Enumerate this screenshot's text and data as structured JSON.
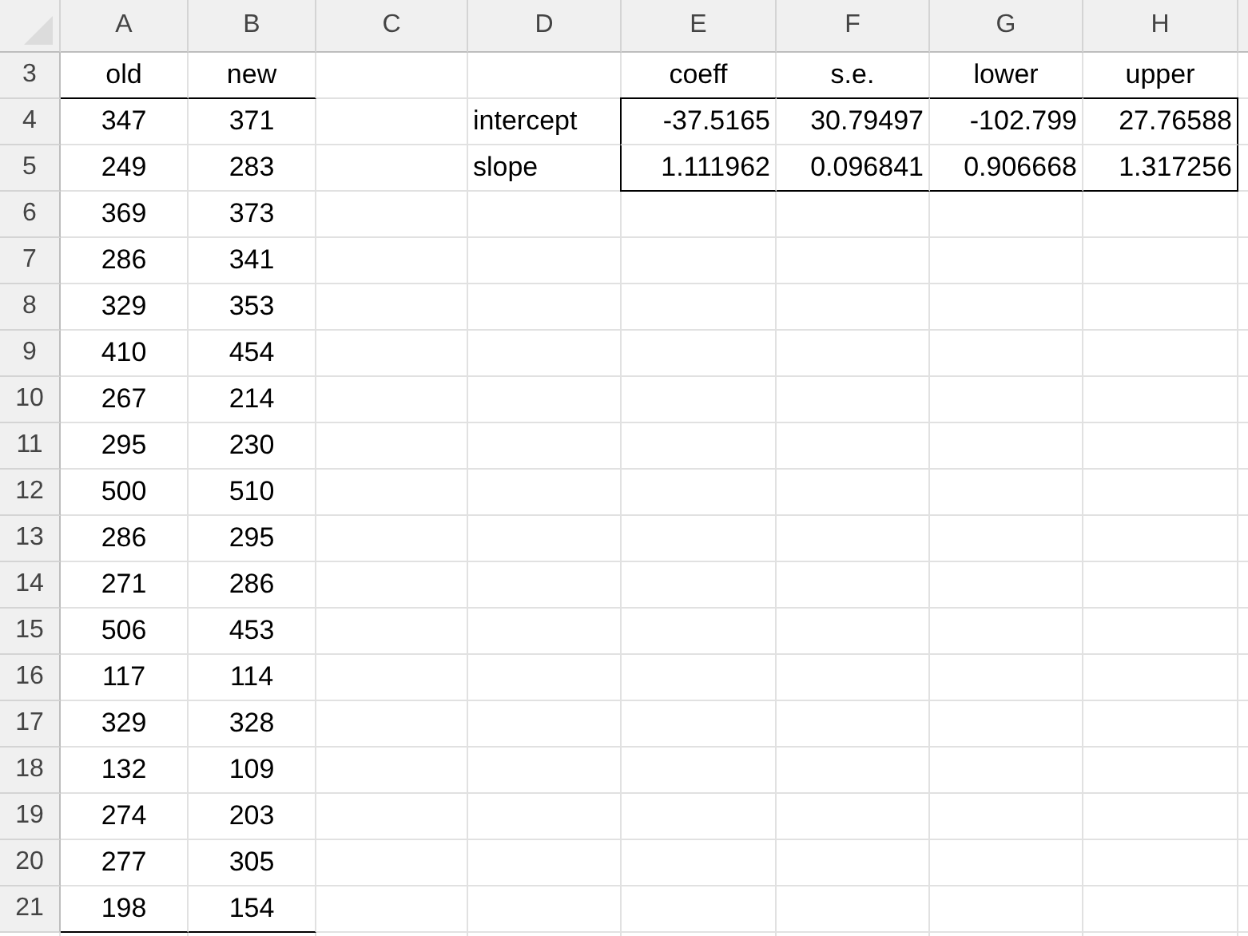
{
  "columns": [
    "A",
    "B",
    "C",
    "D",
    "E",
    "F",
    "G",
    "H"
  ],
  "rows": [
    {
      "number": "3",
      "cells": [
        {
          "text": "old",
          "rule_below": true
        },
        {
          "text": "new",
          "rule_below": true
        },
        null,
        null,
        {
          "text": "coeff"
        },
        {
          "text": "s.e."
        },
        {
          "text": "lower"
        },
        {
          "text": "upper"
        }
      ]
    },
    {
      "number": "4",
      "cells": [
        {
          "text": "347"
        },
        {
          "text": "371"
        },
        null,
        {
          "text": "intercept"
        },
        {
          "text": "-37.5165",
          "boxed": true
        },
        {
          "text": "30.79497",
          "boxed": true
        },
        {
          "text": "-102.799",
          "boxed": true
        },
        {
          "text": "27.76588",
          "boxed": true
        }
      ]
    },
    {
      "number": "5",
      "cells": [
        {
          "text": "249"
        },
        {
          "text": "283"
        },
        null,
        {
          "text": "slope"
        },
        {
          "text": "1.111962",
          "boxed": true
        },
        {
          "text": "0.096841",
          "boxed": true
        },
        {
          "text": "0.906668",
          "boxed": true
        },
        {
          "text": "1.317256",
          "boxed": true
        }
      ]
    },
    {
      "number": "6",
      "cells": [
        {
          "text": "369"
        },
        {
          "text": "373"
        }
      ]
    },
    {
      "number": "7",
      "cells": [
        {
          "text": "286"
        },
        {
          "text": "341"
        }
      ]
    },
    {
      "number": "8",
      "cells": [
        {
          "text": "329"
        },
        {
          "text": "353"
        }
      ]
    },
    {
      "number": "9",
      "cells": [
        {
          "text": "410"
        },
        {
          "text": "454"
        }
      ]
    },
    {
      "number": "10",
      "cells": [
        {
          "text": "267"
        },
        {
          "text": "214"
        }
      ]
    },
    {
      "number": "11",
      "cells": [
        {
          "text": "295"
        },
        {
          "text": "230"
        }
      ]
    },
    {
      "number": "12",
      "cells": [
        {
          "text": "500"
        },
        {
          "text": "510"
        }
      ]
    },
    {
      "number": "13",
      "cells": [
        {
          "text": "286"
        },
        {
          "text": "295"
        }
      ]
    },
    {
      "number": "14",
      "cells": [
        {
          "text": "271"
        },
        {
          "text": "286"
        }
      ]
    },
    {
      "number": "15",
      "cells": [
        {
          "text": "506"
        },
        {
          "text": "453"
        }
      ]
    },
    {
      "number": "16",
      "cells": [
        {
          "text": "117"
        },
        {
          "text": "114"
        }
      ]
    },
    {
      "number": "17",
      "cells": [
        {
          "text": "329"
        },
        {
          "text": "328"
        }
      ]
    },
    {
      "number": "18",
      "cells": [
        {
          "text": "132"
        },
        {
          "text": "109"
        }
      ]
    },
    {
      "number": "19",
      "cells": [
        {
          "text": "274"
        },
        {
          "text": "203"
        }
      ]
    },
    {
      "number": "20",
      "cells": [
        {
          "text": "277"
        },
        {
          "text": "305"
        }
      ]
    },
    {
      "number": "21",
      "cells": [
        {
          "text": "198",
          "rule_below": true
        },
        {
          "text": "154",
          "rule_below": true
        }
      ]
    }
  ]
}
